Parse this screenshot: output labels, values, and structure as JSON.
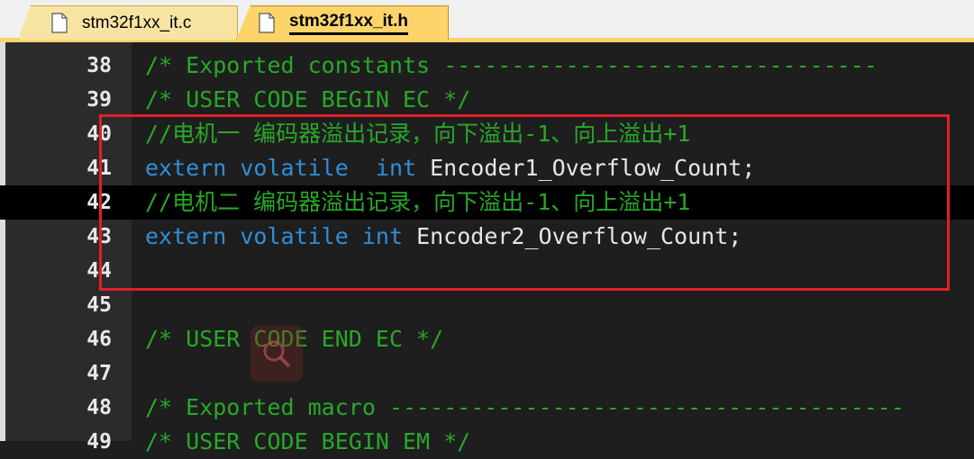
{
  "tabs": [
    {
      "label": "stm32f1xx_it.c",
      "icon": "file-icon",
      "active": false
    },
    {
      "label": "stm32f1xx_it.h",
      "icon": "file-icon",
      "active": true
    }
  ],
  "editor": {
    "lines": [
      {
        "num": "38",
        "comment": "/* Exported constants --------------------------------"
      },
      {
        "num": "39",
        "comment": "/* USER CODE BEGIN EC */"
      },
      {
        "num": "40",
        "comment": "//电机一 编码器溢出记录，向下溢出-1、向上溢出+1"
      },
      {
        "num": "41",
        "kw1": "extern",
        "kw2": "volatile",
        "kw3": "int",
        "ident": "Encoder1_Overflow_Count;"
      },
      {
        "num": "42",
        "comment": "//电机二 编码器溢出记录，向下溢出-1、向上溢出+1"
      },
      {
        "num": "43",
        "kw1": "extern",
        "kw2": "volatile",
        "kw3": "int",
        "ident": "Encoder2_Overflow_Count;"
      },
      {
        "num": "44"
      },
      {
        "num": "45"
      },
      {
        "num": "46",
        "comment": "/* USER CODE END EC */"
      },
      {
        "num": "47"
      },
      {
        "num": "48",
        "comment": "/* Exported macro --------------------------------------"
      },
      {
        "num": "49",
        "comment": "/* USER CODE BEGIN EM */"
      }
    ]
  },
  "colors": {
    "comment": "#28a828",
    "keyword": "#2f8fd8",
    "identifier": "#e6e6e6",
    "highlight_line_bg": "#000000",
    "annotation_box": "#e0202a",
    "active_tab": "#fcd46a"
  }
}
